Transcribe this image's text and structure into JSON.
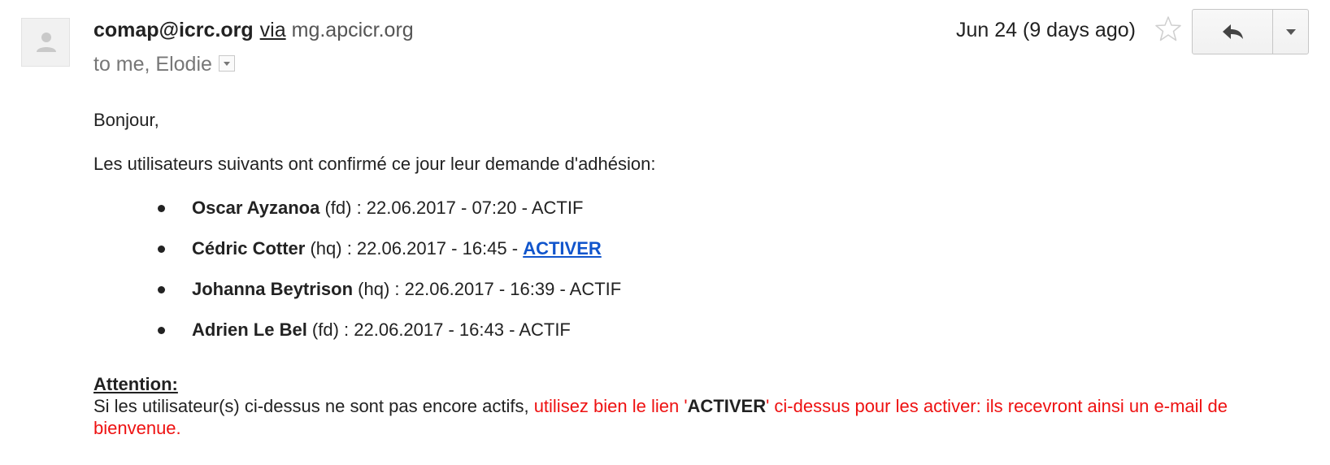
{
  "header": {
    "from": "comap@icrc.org",
    "via_label": "via",
    "via_domain": "mg.apcicr.org",
    "recipients": "to me, Elodie",
    "date": "Jun 24 (9 days ago)"
  },
  "icons": {
    "avatar": "person-icon",
    "star": "star-icon",
    "reply": "reply-arrow-icon",
    "more": "chevron-down-icon",
    "details": "dropdown-arrow-icon"
  },
  "body": {
    "greeting": "Bonjour,",
    "intro": "Les utilisateurs suivants ont confirmé ce jour leur demande d'adhésion:",
    "users": [
      {
        "name": "Oscar Ayzanoa",
        "detail": " (fd) : 22.06.2017 - 07:20 - ",
        "status": "ACTIF",
        "is_link": false
      },
      {
        "name": "Cédric Cotter",
        "detail": " (hq) : 22.06.2017 - 16:45 - ",
        "status": "ACTIVER",
        "is_link": true
      },
      {
        "name": "Johanna Beytrison",
        "detail": " (hq) : 22.06.2017 - 16:39 - ",
        "status": "ACTIF",
        "is_link": false
      },
      {
        "name": "Adrien Le Bel",
        "detail": " (fd) : 22.06.2017 - 16:43 - ",
        "status": "ACTIF",
        "is_link": false
      }
    ],
    "attention_title": "Attention:",
    "attention_plain": "Si les utilisateur(s) ci-dessus ne sont pas encore actifs, ",
    "attention_red_1": "utilisez bien le lien '",
    "attention_red_bold": "ACTIVER",
    "attention_red_2": "' ci-dessus pour les activer: ils recevront ainsi un e-mail de bienvenue."
  },
  "colors": {
    "link": "#1155cc",
    "warning": "#ee1111"
  }
}
